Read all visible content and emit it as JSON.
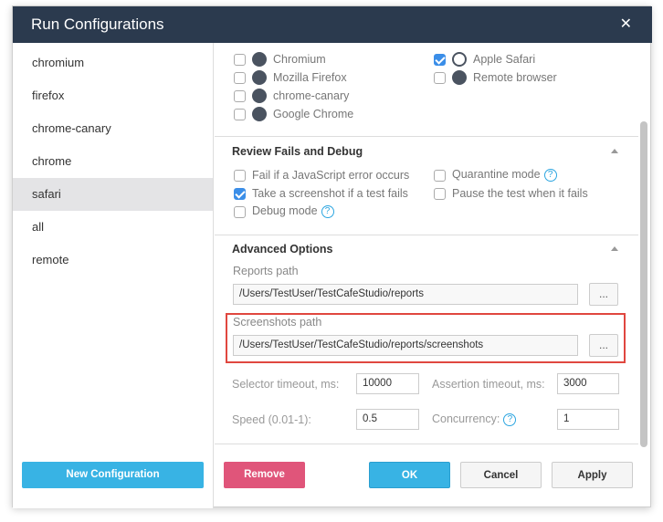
{
  "window": {
    "title": "Run Configurations",
    "close_icon": "close-icon"
  },
  "sidebar": {
    "items": [
      {
        "label": "chromium"
      },
      {
        "label": "firefox"
      },
      {
        "label": "chrome-canary"
      },
      {
        "label": "chrome"
      },
      {
        "label": "safari",
        "selected": true
      },
      {
        "label": "all"
      },
      {
        "label": "remote"
      }
    ],
    "new_config": "New Configuration"
  },
  "browsers": [
    {
      "label": "Chromium",
      "checked": false,
      "icon": "chrome-icon"
    },
    {
      "label": "Mozilla Firefox",
      "checked": false,
      "icon": "firefox-icon"
    },
    {
      "label": "chrome-canary",
      "checked": false,
      "icon": "globe-icon"
    },
    {
      "label": "Google Chrome",
      "checked": false,
      "icon": "chrome-icon"
    },
    {
      "label": "Apple Safari",
      "checked": true,
      "icon": "safari-compass-icon"
    },
    {
      "label": "Remote browser",
      "checked": false,
      "icon": "globe-icon"
    }
  ],
  "review": {
    "title": "Review Fails and Debug",
    "options": [
      {
        "label": "Fail if a JavaScript error occurs",
        "checked": false
      },
      {
        "label": "Take a screenshot if a test fails",
        "checked": true
      },
      {
        "label": "Debug mode",
        "checked": false,
        "help": true
      },
      {
        "label": "Quarantine mode",
        "checked": false,
        "help": true
      },
      {
        "label": "Pause the test when it fails",
        "checked": false
      }
    ]
  },
  "advanced": {
    "title": "Advanced Options",
    "reports_label": "Reports path",
    "reports_value": "/Users/TestUser/TestCafeStudio/reports",
    "screenshots_label": "Screenshots path",
    "screenshots_value": "/Users/TestUser/TestCafeStudio/reports/screenshots",
    "browse": "...",
    "selector_label": "Selector timeout, ms:",
    "selector_value": "10000",
    "assertion_label": "Assertion timeout, ms:",
    "assertion_value": "3000",
    "speed_label": "Speed (0.01-1):",
    "speed_value": "0.5",
    "concurrency_label": "Concurrency:",
    "concurrency_value": "1",
    "help": "?"
  },
  "footer": {
    "remove": "Remove",
    "ok": "OK",
    "cancel": "Cancel",
    "apply": "Apply"
  },
  "colors": {
    "titlebar": "#2b3a4e",
    "primary": "#38b3e4",
    "danger": "#e0557a",
    "highlight": "#e0473f"
  }
}
